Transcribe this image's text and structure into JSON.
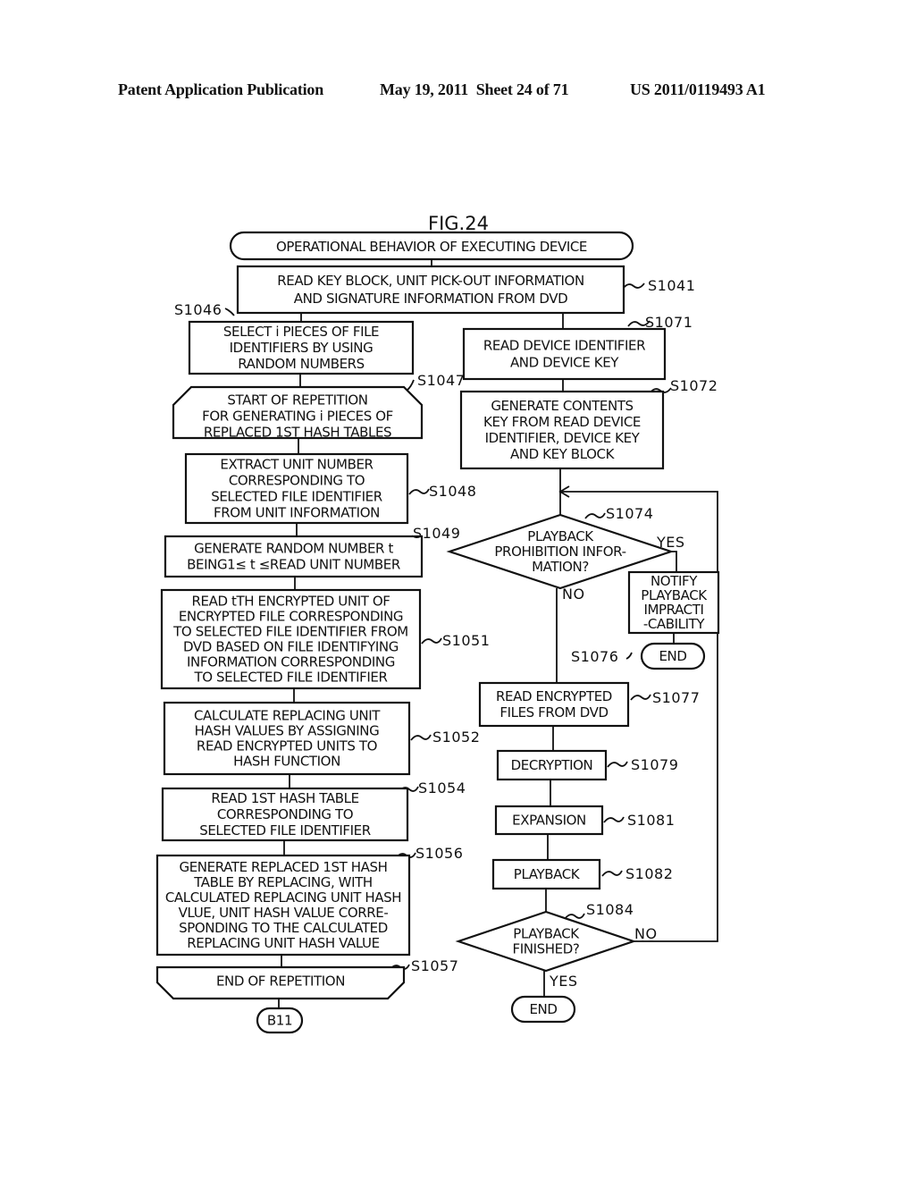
{
  "header": {
    "left": "Patent Application Publication",
    "middle": "May 19, 2011  Sheet 24 of 71",
    "right": "US 2011/0119493 A1"
  },
  "figure": {
    "title": "FIG.24",
    "start": "OPERATIONAL BEHAVIOR OF EXECUTING DEVICE",
    "steps": {
      "s1041": {
        "id": "S1041",
        "lines": [
          "READ KEY BLOCK, UNIT PICK-OUT INFORMATION",
          "AND SIGNATURE INFORMATION FROM DVD"
        ]
      },
      "s1046": {
        "id": "S1046",
        "lines": [
          "SELECT i PIECES OF FILE",
          "IDENTIFIERS BY USING",
          "RANDOM NUMBERS"
        ]
      },
      "s1047": {
        "id": "S1047",
        "lines": [
          "START OF REPETITION",
          "FOR GENERATING i PIECES OF",
          "REPLACED 1ST HASH TABLES"
        ]
      },
      "s1048": {
        "id": "S1048",
        "lines": [
          "EXTRACT UNIT NUMBER",
          "CORRESPONDING TO",
          "SELECTED FILE IDENTIFIER",
          "FROM UNIT INFORMATION"
        ]
      },
      "s1049": {
        "id": "S1049",
        "lines": [
          "GENERATE RANDOM NUMBER t",
          "BEING1≤ t ≤READ UNIT NUMBER"
        ]
      },
      "s1051": {
        "id": "S1051",
        "lines": [
          "READ tTH ENCRYPTED UNIT OF",
          "ENCRYPTED FILE CORRESPONDING",
          "TO SELECTED FILE IDENTIFIER FROM",
          "DVD BASED ON FILE IDENTIFYING",
          "INFORMATION CORRESPONDING",
          "TO SELECTED FILE IDENTIFIER"
        ]
      },
      "s1052": {
        "id": "S1052",
        "lines": [
          "CALCULATE REPLACING UNIT",
          "HASH VALUES BY ASSIGNING",
          "READ ENCRYPTED UNITS TO",
          "HASH FUNCTION"
        ]
      },
      "s1054": {
        "id": "S1054",
        "lines": [
          "READ 1ST HASH TABLE",
          "CORRESPONDING TO",
          "SELECTED FILE IDENTIFIER"
        ]
      },
      "s1056": {
        "id": "S1056",
        "lines": [
          "GENERATE REPLACED 1ST HASH",
          "TABLE BY REPLACING, WITH",
          "CALCULATED REPLACING UNIT HASH",
          "VLUE, UNIT HASH VALUE CORRE-",
          "SPONDING TO THE CALCULATED",
          "REPLACING UNIT HASH VALUE"
        ]
      },
      "s1057": {
        "id": "S1057",
        "lines": [
          "END OF REPETITION"
        ]
      },
      "b11": {
        "lines": [
          "B11"
        ]
      },
      "s1071": {
        "id": "S1071",
        "lines": [
          "READ DEVICE IDENTIFIER",
          "AND DEVICE KEY"
        ]
      },
      "s1072": {
        "id": "S1072",
        "lines": [
          "GENERATE CONTENTS",
          "KEY FROM READ DEVICE",
          "IDENTIFIER, DEVICE KEY",
          "AND KEY BLOCK"
        ]
      },
      "s1074": {
        "id": "S1074",
        "lines": [
          "PLAYBACK",
          "PROHIBITION INFOR-",
          "MATION?"
        ],
        "yes": "YES",
        "no": "NO"
      },
      "s1076": {
        "id": "S1076",
        "lines": [
          "NOTIFY",
          "PLAYBACK",
          "IMPRACTI",
          "-CABILITY"
        ]
      },
      "end1": {
        "lines": [
          "END"
        ]
      },
      "s1077": {
        "id": "S1077",
        "lines": [
          "READ ENCRYPTED",
          "FILES FROM DVD"
        ]
      },
      "s1079": {
        "id": "S1079",
        "lines": [
          "DECRYPTION"
        ]
      },
      "s1081": {
        "id": "S1081",
        "lines": [
          "EXPANSION"
        ]
      },
      "s1082": {
        "id": "S1082",
        "lines": [
          "PLAYBACK"
        ]
      },
      "s1084": {
        "id": "S1084",
        "lines": [
          "PLAYBACK",
          "FINISHED?"
        ],
        "yes": "YES",
        "no": "NO"
      },
      "end2": {
        "lines": [
          "END"
        ]
      }
    }
  }
}
